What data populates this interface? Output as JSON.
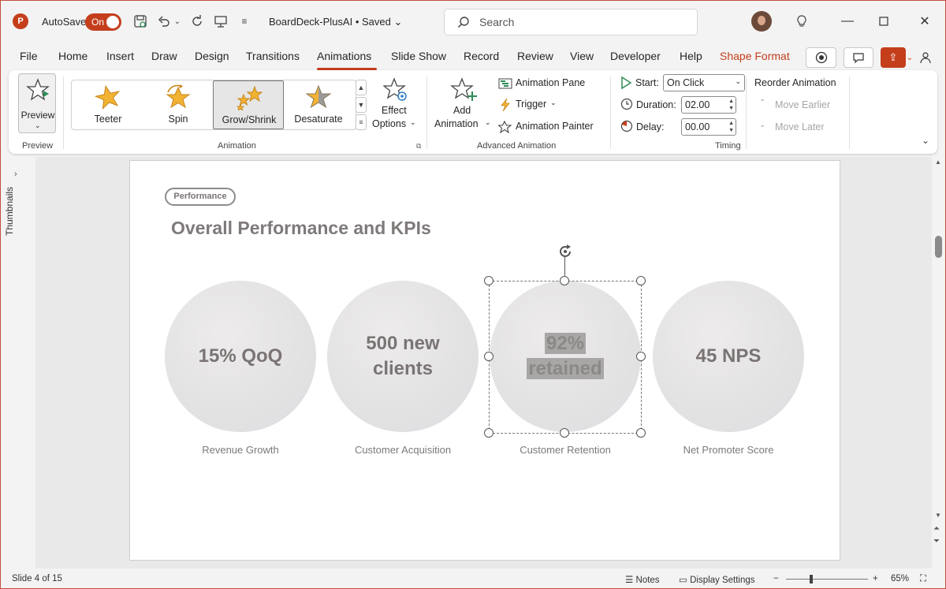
{
  "titlebar": {
    "app_icon": "P",
    "autosave_label": "AutoSave",
    "autosave_state": "On",
    "doc_title": "BoardDeck-PlusAI • Saved",
    "search_placeholder": "Search"
  },
  "tabs": [
    "File",
    "Home",
    "Insert",
    "Draw",
    "Design",
    "Transitions",
    "Animations",
    "Slide Show",
    "Record",
    "Review",
    "View",
    "Developer",
    "Help",
    "Shape Format"
  ],
  "active_tab": "Animations",
  "ribbon": {
    "preview": {
      "label": "Preview",
      "group": "Preview"
    },
    "animation": {
      "group": "Animation",
      "gallery": [
        {
          "label": "Teeter",
          "icon": "teeter-star-icon"
        },
        {
          "label": "Spin",
          "icon": "spin-star-icon"
        },
        {
          "label": "Grow/Shrink",
          "icon": "grow-shrink-star-icon",
          "selected": true
        },
        {
          "label": "Desaturate",
          "icon": "desaturate-star-icon"
        }
      ],
      "effect_options_line1": "Effect",
      "effect_options_line2": "Options"
    },
    "advanced": {
      "group": "Advanced Animation",
      "add_animation_line1": "Add",
      "add_animation_line2": "Animation",
      "animation_pane": "Animation Pane",
      "trigger": "Trigger",
      "animation_painter": "Animation Painter"
    },
    "timing": {
      "group": "Timing",
      "start_label": "Start:",
      "start_value": "On Click",
      "duration_label": "Duration:",
      "duration_value": "02.00",
      "delay_label": "Delay:",
      "delay_value": "00.00",
      "reorder_title": "Reorder Animation",
      "move_earlier": "Move Earlier",
      "move_later": "Move Later"
    }
  },
  "thumbnails_label": "Thumbnails",
  "slide": {
    "pill": "Performance",
    "title": "Overall Performance and KPIs",
    "kpis": [
      {
        "value_line1": "15% QoQ",
        "value_line2": "",
        "label": "Revenue Growth"
      },
      {
        "value_line1": "500 new",
        "value_line2": "clients",
        "label": "Customer Acquisition"
      },
      {
        "value_line1": "92%",
        "value_line2": "retained",
        "label": "Customer Retention",
        "selected": true
      },
      {
        "value_line1": "45 NPS",
        "value_line2": "",
        "label": "Net Promoter Score"
      }
    ]
  },
  "statusbar": {
    "slide_info": "Slide 4 of 15",
    "notes": "Notes",
    "display_settings": "Display Settings",
    "zoom": "65%"
  },
  "colors": {
    "accent": "#c43e1c",
    "kpi_text": "#7a7474"
  }
}
